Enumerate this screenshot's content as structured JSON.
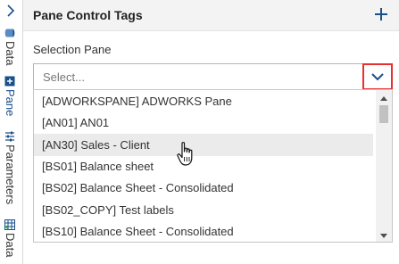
{
  "panel": {
    "title": "Pane Control Tags",
    "add_icon": "plus-icon"
  },
  "side_tabs": [
    {
      "label": "Data",
      "icon": "database-icon"
    },
    {
      "label": "Pane",
      "icon": "pane-icon"
    },
    {
      "label": "Parameters",
      "icon": "parameters-icon"
    },
    {
      "label": "Data",
      "icon": "data-table-icon"
    }
  ],
  "selection": {
    "label": "Selection Pane",
    "placeholder": "Select...",
    "dropdown_icon": "chevron-down-icon"
  },
  "options": [
    "[ADWORKSPANE] ADWORKS Pane",
    "[AN01] AN01",
    "[AN30] Sales - Client",
    "[BS01] Balance sheet",
    "[BS02] Balance Sheet - Consolidated",
    "[BS02_COPY] Test labels",
    "[BS10] Balance Sheet - Consolidated"
  ],
  "hovered_option_index": 2,
  "colors": {
    "accent": "#1a4f8a",
    "highlight_border": "#e8302e",
    "hover_row": "#ebebeb"
  }
}
